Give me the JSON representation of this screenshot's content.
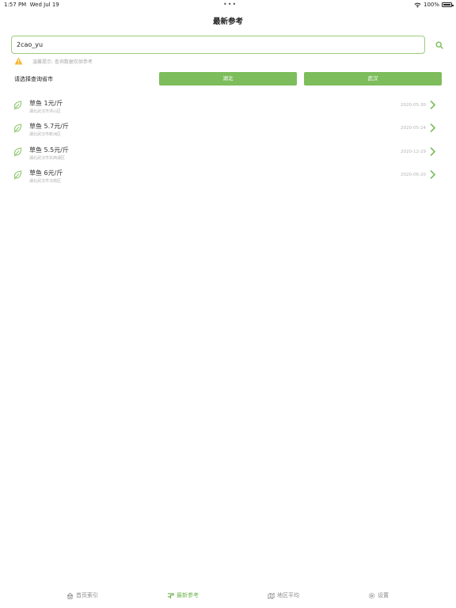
{
  "status_bar": {
    "time": "1:57 PM",
    "date": "Wed Jul 19",
    "battery": "100%"
  },
  "nav": {
    "title": "最新参考"
  },
  "search": {
    "value": "2cao_yu"
  },
  "notice": {
    "text": "温馨提示: 查询数据仅供参考"
  },
  "selector": {
    "label": "请选择查询省市",
    "province": "湖北",
    "city": "武汉"
  },
  "results": [
    {
      "title": "草鱼 1元/斤",
      "location": "湖北武汉市洪山区",
      "date": "2020-05-30"
    },
    {
      "title": "草鱼 5.7元/斤",
      "location": "湖北武汉市新洲区",
      "date": "2020-05-24"
    },
    {
      "title": "草鱼 5.5元/斤",
      "location": "湖北武汉市东西湖区",
      "date": "2020-12-29"
    },
    {
      "title": "草鱼 6元/斤",
      "location": "湖北武汉市汉南区",
      "date": "2020-06-20"
    }
  ],
  "tabs": [
    {
      "label": "首页索引",
      "icon": "home-index-icon"
    },
    {
      "label": "最新参考",
      "icon": "latest-reference-icon"
    },
    {
      "label": "地区平均",
      "icon": "region-average-icon"
    },
    {
      "label": "设置",
      "icon": "gear-icon"
    }
  ],
  "colors": {
    "accent": "#7dbd5b",
    "warning": "#f5b731"
  }
}
